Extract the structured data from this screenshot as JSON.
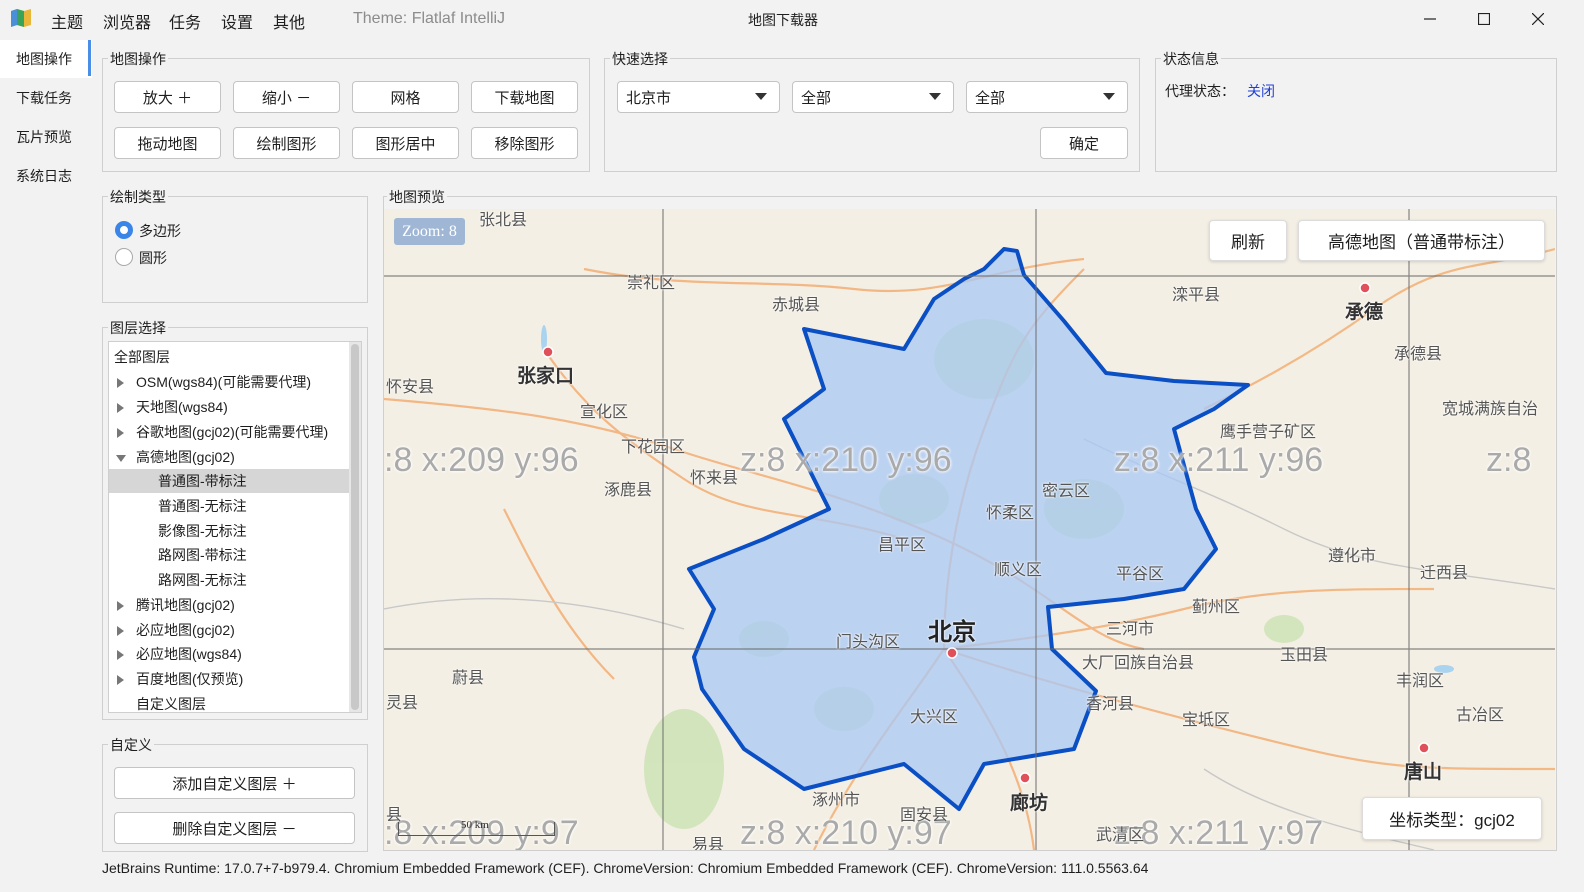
{
  "menu": [
    "主题",
    "浏览器",
    "任务",
    "设置",
    "其他"
  ],
  "theme_label": "Theme: Flatlaf IntelliJ",
  "window_title": "地图下载器",
  "nav": [
    "地图操作",
    "下载任务",
    "瓦片预览",
    "系统日志"
  ],
  "map_ops": {
    "title": "地图操作",
    "buttons": [
      "放大 ＋",
      "缩小 －",
      "网格",
      "下载地图",
      "拖动地图",
      "绘制图形",
      "图形居中",
      "移除图形"
    ]
  },
  "quick": {
    "title": "快速选择",
    "province": "北京市",
    "city": "全部",
    "district": "全部",
    "confirm": "确定"
  },
  "status_info": {
    "title": "状态信息",
    "proxy_label": "代理状态：",
    "proxy_value": "关闭",
    "proxy_value_color": "#1f3fd6"
  },
  "draw_type": {
    "title": "绘制类型",
    "options": [
      "多边形",
      "圆形"
    ],
    "selected": "多边形"
  },
  "layers": {
    "title": "图层选择",
    "root": "全部图层",
    "groups_before": [
      "OSM(wgs84)(可能需要代理)",
      "天地图(wgs84)",
      "谷歌地图(gcj02)(可能需要代理)"
    ],
    "expanded_group": "高德地图(gcj02)",
    "expanded_children": [
      "普通图-带标注",
      "普通图-无标注",
      "影像图-无标注",
      "路网图-带标注",
      "路网图-无标注"
    ],
    "selected_child": "普通图-带标注",
    "groups_after": [
      "腾讯地图(gcj02)",
      "必应地图(gcj02)",
      "必应地图(wgs84)",
      "百度地图(仅预览)"
    ],
    "custom": "自定义图层"
  },
  "custom": {
    "title": "自定义",
    "add": "添加自定义图层 ＋",
    "remove": "删除自定义图层 －"
  },
  "map": {
    "title": "地图预览",
    "zoom": "Zoom: 8",
    "refresh": "刷新",
    "layer_button": "高德地图（普通带标注）",
    "coord_type": "坐标类型：gcj02",
    "scale": "50 km",
    "tiles": [
      ":8 x:209 y:96",
      "z:8 x:210 y:96",
      "z:8 x:211 y:96",
      "z:8",
      ":8 x:209 y:97",
      "z:8 x:210 y:97",
      "z:8 x:211 y:97"
    ],
    "places": [
      "张北县",
      "崇礼区",
      "赤城县",
      "滦平县",
      "承德",
      "承德县",
      "张家口",
      "怀安县",
      "宣化区",
      "下花园区",
      "怀来县",
      "涿鹿县",
      "鹰手营子矿区",
      "宽城满族自治",
      "密云区",
      "怀柔区",
      "昌平区",
      "顺义区",
      "平谷区",
      "遵化市",
      "迁西县",
      "蓟州区",
      "三河市",
      "玉田县",
      "门头沟区",
      "北京",
      "蔚县",
      "大厂回族自治县",
      "香河县",
      "宝坻区",
      "丰润区",
      "古冶区",
      "大兴区",
      "唐山",
      "涿州市",
      "廊坊",
      "固安县",
      "易县",
      "武清区",
      "灵县",
      "县"
    ],
    "boundary_color": "#0a4fc4",
    "fill_color": "#a9c8f5"
  },
  "statusbar": "JetBrains Runtime: 17.0.7+7-b979.4. Chromium Embedded Framework (CEF). ChromeVersion: Chromium Embedded Framework (CEF). ChromeVersion: 111.0.5563.64"
}
